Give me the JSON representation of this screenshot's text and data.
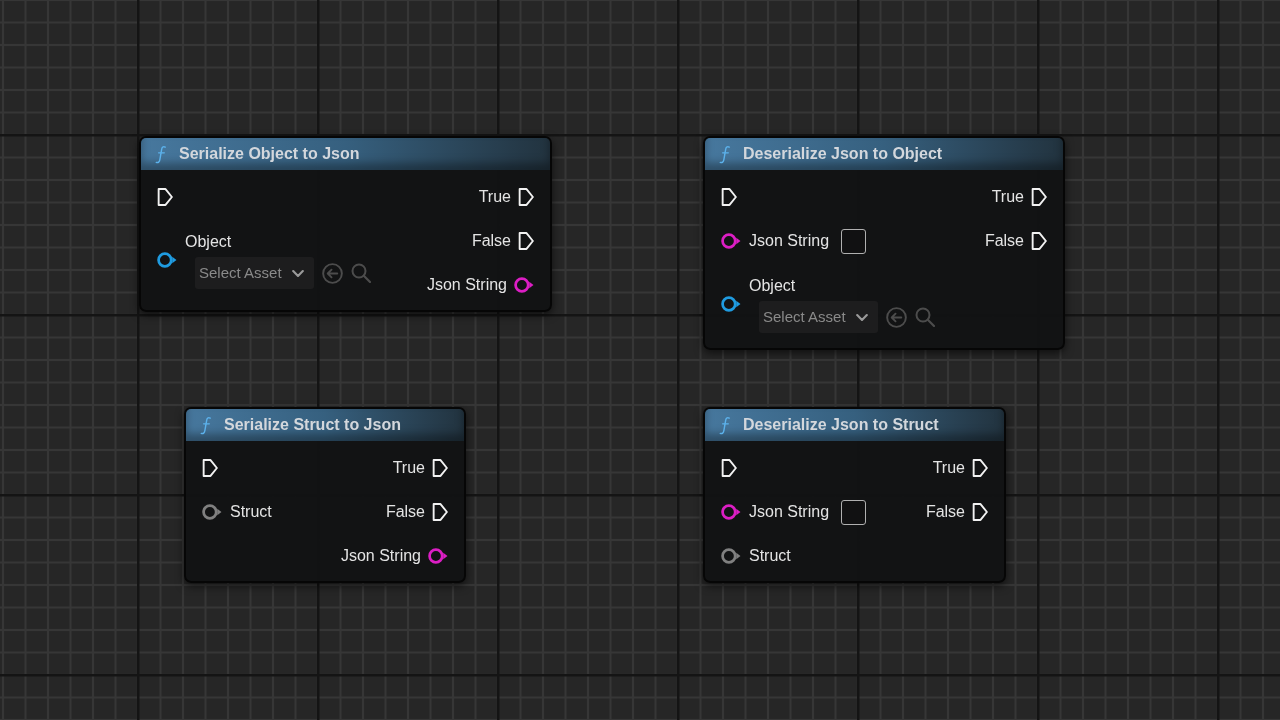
{
  "nodes": [
    {
      "title": "Serialize Object to Json",
      "inputs": [
        {
          "kind": "exec"
        },
        {
          "kind": "object",
          "label": "Object",
          "asset_picker": {
            "text": "Select Asset"
          }
        }
      ],
      "outputs": [
        {
          "kind": "exec",
          "label": "True"
        },
        {
          "kind": "exec",
          "label": "False"
        },
        {
          "kind": "string",
          "label": "Json String"
        }
      ]
    },
    {
      "title": "Deserialize Json to Object",
      "inputs": [
        {
          "kind": "exec"
        },
        {
          "kind": "string",
          "label": "Json String",
          "text_box": true
        },
        {
          "kind": "object",
          "label": "Object",
          "asset_picker": {
            "text": "Select Asset"
          }
        }
      ],
      "outputs": [
        {
          "kind": "exec",
          "label": "True"
        },
        {
          "kind": "exec",
          "label": "False"
        }
      ]
    },
    {
      "title": "Serialize Struct to Json",
      "inputs": [
        {
          "kind": "exec"
        },
        {
          "kind": "struct",
          "label": "Struct"
        }
      ],
      "outputs": [
        {
          "kind": "exec",
          "label": "True"
        },
        {
          "kind": "exec",
          "label": "False"
        },
        {
          "kind": "string",
          "label": "Json String"
        }
      ]
    },
    {
      "title": "Deserialize Json to Struct",
      "inputs": [
        {
          "kind": "exec"
        },
        {
          "kind": "string",
          "label": "Json String",
          "text_box": true
        },
        {
          "kind": "struct",
          "label": "Struct"
        }
      ],
      "outputs": [
        {
          "kind": "exec",
          "label": "True"
        },
        {
          "kind": "exec",
          "label": "False"
        }
      ]
    }
  ]
}
